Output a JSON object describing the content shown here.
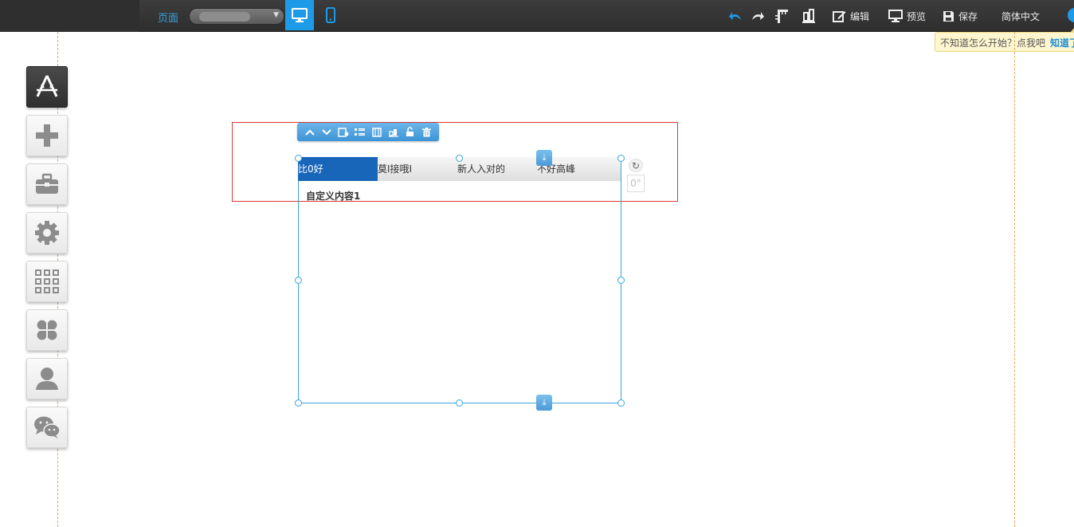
{
  "topbar": {
    "page_label": "页面",
    "views": [
      "desktop-view",
      "mobile-view"
    ],
    "active_view": "desktop-view",
    "actions": {
      "undo_icon": "undo-icon",
      "redo_icon": "redo-icon",
      "edit_label": "编辑",
      "preview_label": "预览",
      "save_label": "保存",
      "language_label": "简体中文"
    },
    "accent_color": "#1e9be8"
  },
  "tip": {
    "text": "不知道怎么开始？点我吧",
    "link": "知道了"
  },
  "sidebar": {
    "items": [
      {
        "name": "app-store",
        "icon": "app-store-icon"
      },
      {
        "name": "add",
        "icon": "plus-icon"
      },
      {
        "name": "toolbox",
        "icon": "toolbox-icon"
      },
      {
        "name": "settings",
        "icon": "gear-icon"
      },
      {
        "name": "grid",
        "icon": "grid-icon"
      },
      {
        "name": "widgets",
        "icon": "clover-icon"
      },
      {
        "name": "user",
        "icon": "user-icon"
      },
      {
        "name": "wechat",
        "icon": "wechat-icon"
      }
    ]
  },
  "module": {
    "toolbar_icons": [
      "move-up-icon",
      "move-down-icon",
      "settings-icon",
      "list-icon",
      "columns-icon",
      "layers-icon",
      "unlock-icon",
      "delete-icon"
    ],
    "tabs": [
      "比0好",
      "莫I接哦I",
      "新人入对的",
      "不好高峰"
    ],
    "active_tab": 0,
    "content_title": "自定义内容1",
    "rotation": "0°"
  }
}
